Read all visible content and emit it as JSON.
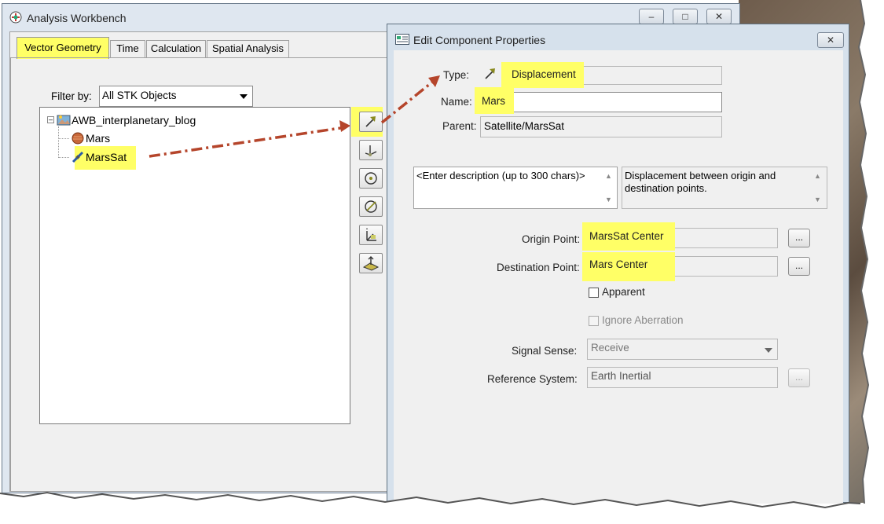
{
  "main_window": {
    "title": "Analysis Workbench",
    "tabs": [
      {
        "label": "Vector Geometry"
      },
      {
        "label": "Time"
      },
      {
        "label": "Calculation"
      },
      {
        "label": "Spatial Analysis"
      }
    ],
    "filter_label": "Filter by:",
    "filter_value": "All STK Objects",
    "tree": {
      "root": "AWB_interplanetary_blog",
      "children": [
        {
          "label": "Mars",
          "icon": "planet-icon"
        },
        {
          "label": "MarsSat",
          "icon": "satellite-icon"
        }
      ]
    },
    "toolbar_icons": [
      "vector-icon",
      "axes-icon",
      "point-icon",
      "angle-icon",
      "system-icon",
      "plane-icon"
    ],
    "caption_buttons": {
      "minimize": "–",
      "maximize": "□",
      "close": "✕"
    }
  },
  "dialog": {
    "title": "Edit Component Properties",
    "close": "✕",
    "type_label": "Type:",
    "type_value": "Displacement",
    "name_label": "Name:",
    "name_value": "Mars",
    "parent_label": "Parent:",
    "parent_value": "Satellite/MarsSat",
    "description_placeholder": "<Enter description (up to 300 chars)>",
    "type_description": "Displacement between origin and destination points.",
    "origin_label": "Origin Point:",
    "origin_value": "MarsSat Center",
    "destination_label": "Destination Point:",
    "destination_value": "Mars Center",
    "browse_label": "...",
    "apparent_label": "Apparent",
    "ignore_aberration_label": "Ignore Aberration",
    "signal_sense_label": "Signal Sense:",
    "signal_sense_value": "Receive",
    "reference_system_label": "Reference System:",
    "reference_system_value": "Earth Inertial"
  },
  "colors": {
    "highlight": "#ffff66",
    "annotation_arrow": "#b5452b"
  }
}
